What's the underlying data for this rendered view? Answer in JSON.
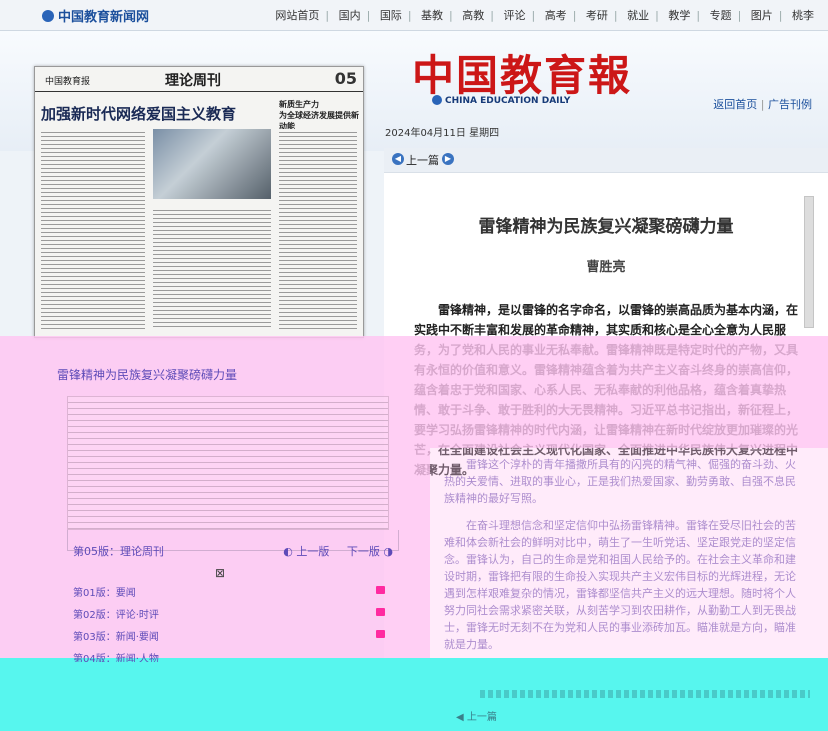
{
  "site": {
    "logo_text": "中国教育新闻网",
    "nav": [
      "网站首页",
      "国内",
      "国际",
      "基教",
      "高教",
      "评论",
      "高考",
      "考研",
      "就业",
      "教学",
      "专题",
      "图片",
      "桃李"
    ]
  },
  "masthead": {
    "title": "中国教育報",
    "english": "CHINA EDUCATION DAILY",
    "links": [
      "返回首页",
      "广告刊例"
    ]
  },
  "date": "2024年04月11日 星期四",
  "thumb": {
    "paper_logo": "中国教育报",
    "section": "理论周刊",
    "page_no": "05",
    "headline": "加强新时代网络爱国主义教育",
    "side_headline": "新质生产力\n为全球经济发展提供新动能"
  },
  "article": {
    "prev_label": "上一篇",
    "title": "雷锋精神为民族复兴凝聚磅礴力量",
    "author": "曹胜亮",
    "lead": "雷锋精神，是以雷锋的名字命名，以雷锋的崇高品质为基本内涵，在实践中不断丰富和发展的革命精神，其实质和核心是全心全意为人民服务，为了党和人民的事业无私奉献。雷锋精神既是特定时代的产物，又具有永恒的价值和意义。雷锋精神蕴含着为共产主义奋斗终身的崇高信仰，蕴含着忠于党和国家、心系人民、无私奉献的利他品格，蕴含着真挚热情、敢于斗争、敢于胜利的大无畏精神。习近平总书记指出，新征程上，要学习弘扬雷锋精神的时代内涵，让雷锋精神在新时代绽放更加璀璨的光芒，在全面建设社会主义现代化国家、全面推进中华民族伟大复兴进程中凝聚力量。",
    "paragraphs": [
      "雷锋这个淳朴的青年播撒所具有的闪亮的精气神、倔强的奋斗劲、火热的关爱情、进取的事业心，正是我们热爱国家、勤劳勇敢、自强不息民族精神的最好写照。",
      "在奋斗理想信念和坚定信仰中弘扬雷锋精神。雷锋在受尽旧社会的苦难和体会新社会的鲜明对比中，萌生了一生听党话、坚定跟党走的坚定信念。雷锋认为，自己的生命是党和祖国人民给予的。在社会主义革命和建设时期，雷锋把有限的生命投入实现共产主义宏伟目标的光辉进程，无论遇到怎样艰难复杂的情况，雷锋都坚信共产主义的远大理想。随时将个人努力同社会需求紧密关联，从刻苦学习到农田耕作，从勤勤工人到无畏战士，雷锋无时无刻不在为党和人民的事业添砖加瓦。瞄准就是方向，瞄准就是力量。"
    ]
  },
  "left_panel": {
    "headline": "雷锋精神为民族复兴凝聚磅礴力量",
    "current_page": "第05版：理论周刊",
    "prev_page": "上一版",
    "next_page": "下一版",
    "pages": [
      "第01版：要闻",
      "第02版：评论·时评",
      "第03版：新闻·要闻",
      "第04版：新闻·人物"
    ]
  },
  "bottom": {
    "prev_label": "上一篇"
  }
}
